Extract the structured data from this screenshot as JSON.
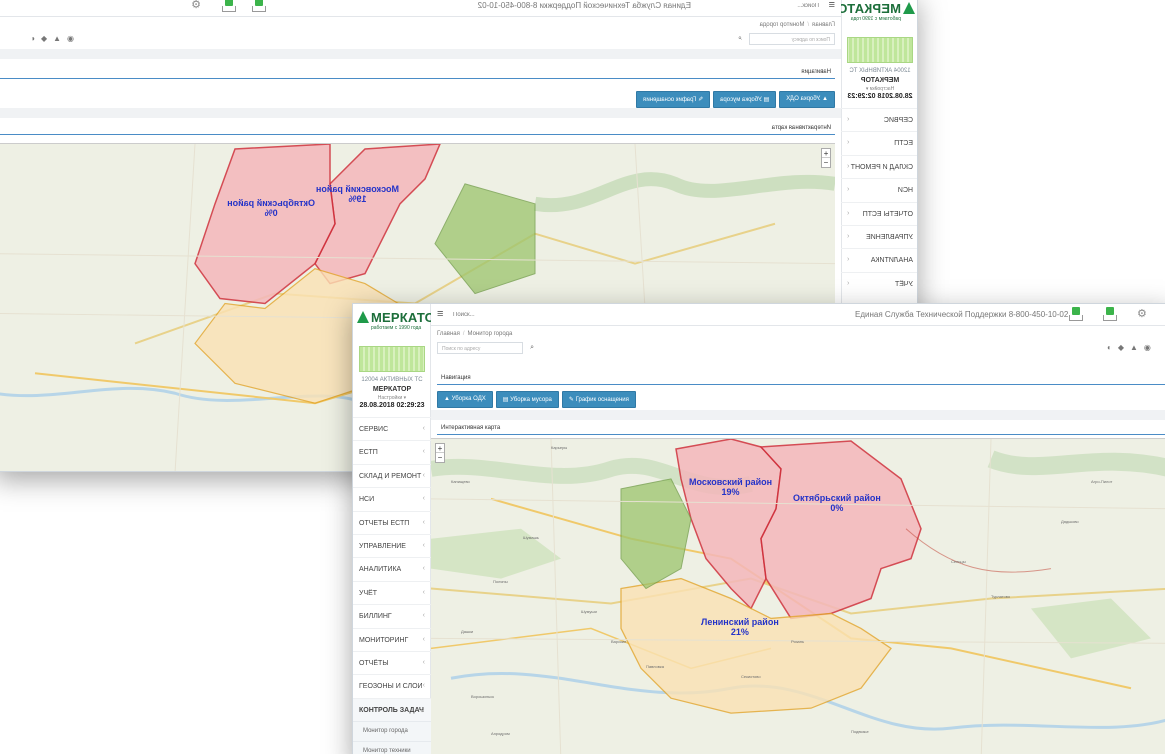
{
  "logo": {
    "name": "МЕРКАТОР",
    "tagline": "работаем с 1990 года"
  },
  "status": {
    "active_ts": "12004 АКТИВНЫХ ТС",
    "org": "МЕРКАТОР",
    "settings": "Настройки ▾",
    "datetime": "28.08.2018 02:29:23"
  },
  "topbar": {
    "search_placeholder": "Поиск...",
    "support": "Единая Служба Технической Поддержки 8-800-450-10-02"
  },
  "breadcrumb": {
    "home": "Главная",
    "current": "Монитор города"
  },
  "address_search": {
    "placeholder": "Поиск по адресу"
  },
  "navigation": {
    "title": "Навигация",
    "buttons": [
      "Уборка ОДХ",
      "Уборка мусора",
      "График оснащения"
    ]
  },
  "map_panel": {
    "title": "Интерактивная карта"
  },
  "menu": {
    "items": [
      "СЕРВИС",
      "ЕСТП",
      "СКЛАД И РЕМОНТ",
      "НСИ",
      "ОТЧЕТЫ ЕСТП",
      "УПРАВЛЕНИЕ",
      "АНАЛИТИКА",
      "УЧЁТ",
      "БИЛЛИНГ",
      "МОНИТОРИНГ",
      "ОТЧЁТЫ",
      "ГЕОЗОНЫ И СЛОИ",
      "КОНТРОЛЬ ЗАДАЧ"
    ],
    "subitems": [
      "Монитор города",
      "Монитор техники"
    ]
  },
  "districts": [
    {
      "name": "Московский район",
      "percent": "19%"
    },
    {
      "name": "Октябрьский район",
      "percent": "0%"
    },
    {
      "name": "Ленинский район",
      "percent": "21%"
    }
  ],
  "map_labels": [
    "Карьеры",
    "Канищево",
    "Шумашь",
    "Поляны",
    "Дашки",
    "Варские",
    "Павловка",
    "Секиотово",
    "Ворошильск",
    "Сельцы",
    "Турлатово",
    "Дядьково",
    "Агро-Пилот",
    "Рязань",
    "Шумуши",
    "Подвязье",
    "Аэродром"
  ],
  "colors": {
    "accent": "#3c8dbc",
    "district_fill": "#f2aab0",
    "district_border": "#d0303c",
    "green_area": "#8fbf5a",
    "label": "#2433c8"
  }
}
